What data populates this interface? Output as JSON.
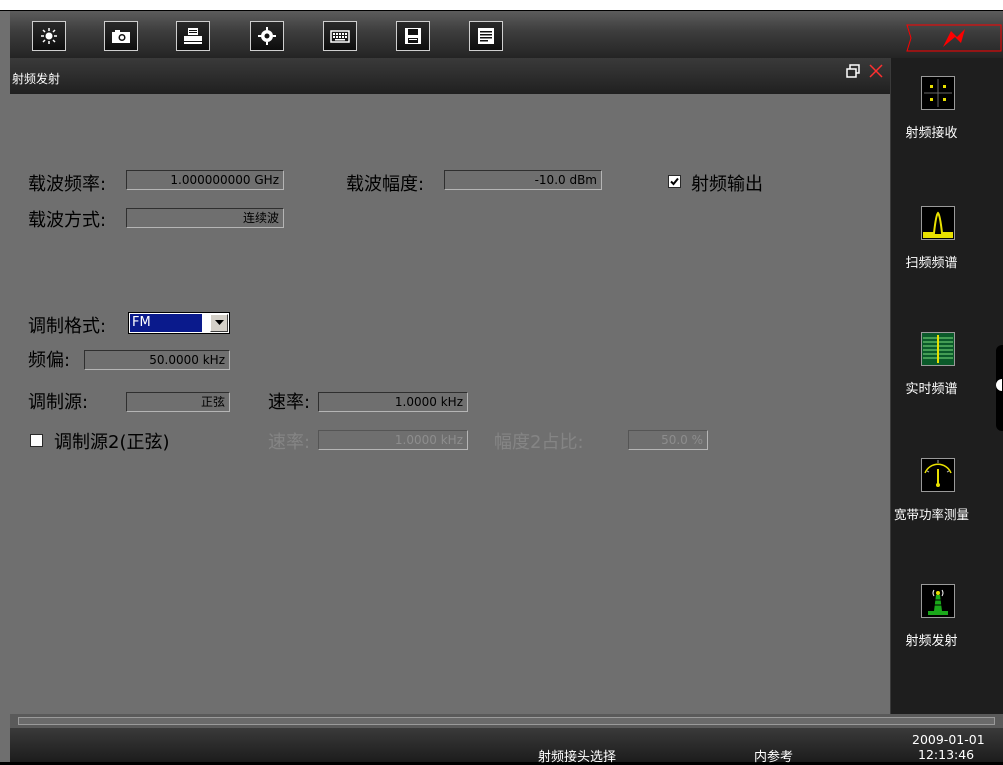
{
  "window": {
    "title": "射频发射"
  },
  "toolbar": {
    "buttons": [
      {
        "icon": "brightness-icon"
      },
      {
        "icon": "camera-icon"
      },
      {
        "icon": "print-icon"
      },
      {
        "icon": "settings-icon"
      },
      {
        "icon": "keyboard-icon"
      },
      {
        "icon": "save-icon"
      },
      {
        "icon": "document-icon"
      }
    ]
  },
  "form": {
    "carrier_freq": {
      "label": "载波频率:",
      "value": "1.000000000 GHz"
    },
    "carrier_amp": {
      "label": "载波幅度:",
      "value": "-10.0 dBm"
    },
    "rf_output": {
      "label": "射频输出",
      "checked": true
    },
    "carrier_mode": {
      "label": "载波方式:",
      "value": "连续波"
    },
    "mod_format": {
      "label": "调制格式:",
      "value": "FM"
    },
    "freq_dev": {
      "label": "频偏:",
      "value": "50.0000 kHz"
    },
    "mod_source": {
      "label": "调制源:",
      "value": "正弦"
    },
    "rate1": {
      "label": "速率:",
      "value": "1.0000 kHz"
    },
    "mod_source2": {
      "label": "调制源2(正弦)",
      "checked": false
    },
    "rate2": {
      "label": "速率:",
      "value": "1.0000 kHz"
    },
    "amp_ratio": {
      "label": "幅度2占比:",
      "value": "50.0 %"
    }
  },
  "sidebar": {
    "items": [
      {
        "label": "射频接收",
        "icon": "rf-receive-icon"
      },
      {
        "label": "扫频频谱",
        "icon": "sweep-spectrum-icon"
      },
      {
        "label": "实时频谱",
        "icon": "realtime-spectrum-icon"
      },
      {
        "label": "宽带功率测量",
        "icon": "power-meter-icon"
      },
      {
        "label": "射频发射",
        "icon": "rf-transmit-icon"
      }
    ]
  },
  "status": {
    "rf_head": "射频接头选择",
    "reference": "内参考",
    "date": "2009-01-01",
    "time": "12:13:46"
  },
  "colors": {
    "accent": "#ff0000",
    "panel": "#6f6f6f",
    "selection": "#0a1a8c"
  }
}
